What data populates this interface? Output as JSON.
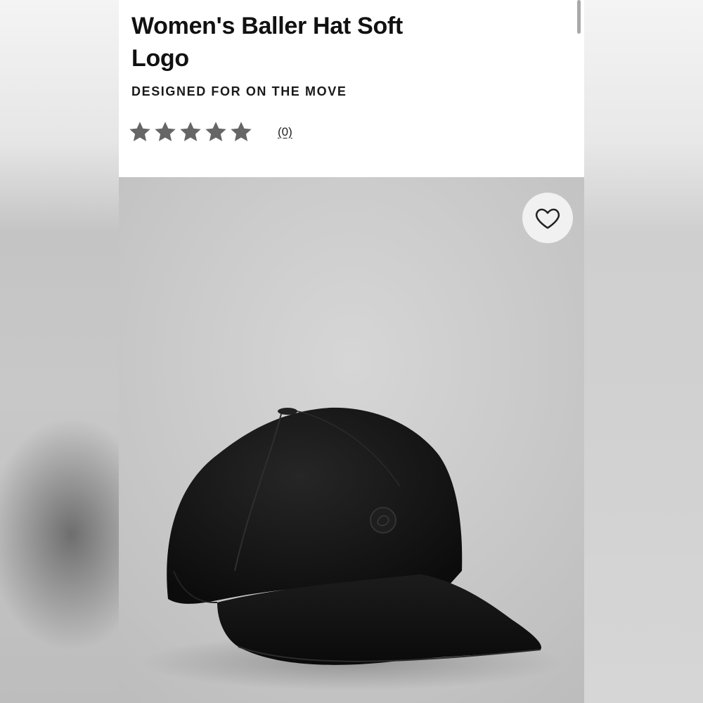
{
  "product": {
    "title": "Women's Baller Hat Soft Logo",
    "tagline": "DESIGNED FOR ON THE MOVE",
    "rating": {
      "stars": 5,
      "filled_stars": 5,
      "review_count_label": "(0)",
      "star_color": "#666666"
    },
    "image": {
      "subject": "black baseball cap with circular logo patch",
      "background_color": "#cbcbcb",
      "cap_color": "#141414"
    }
  },
  "wishlist": {
    "icon": "heart-icon"
  },
  "colors": {
    "text": "#111111",
    "header_bg": "#ffffff",
    "scrollbar": "#a9a9a9"
  }
}
